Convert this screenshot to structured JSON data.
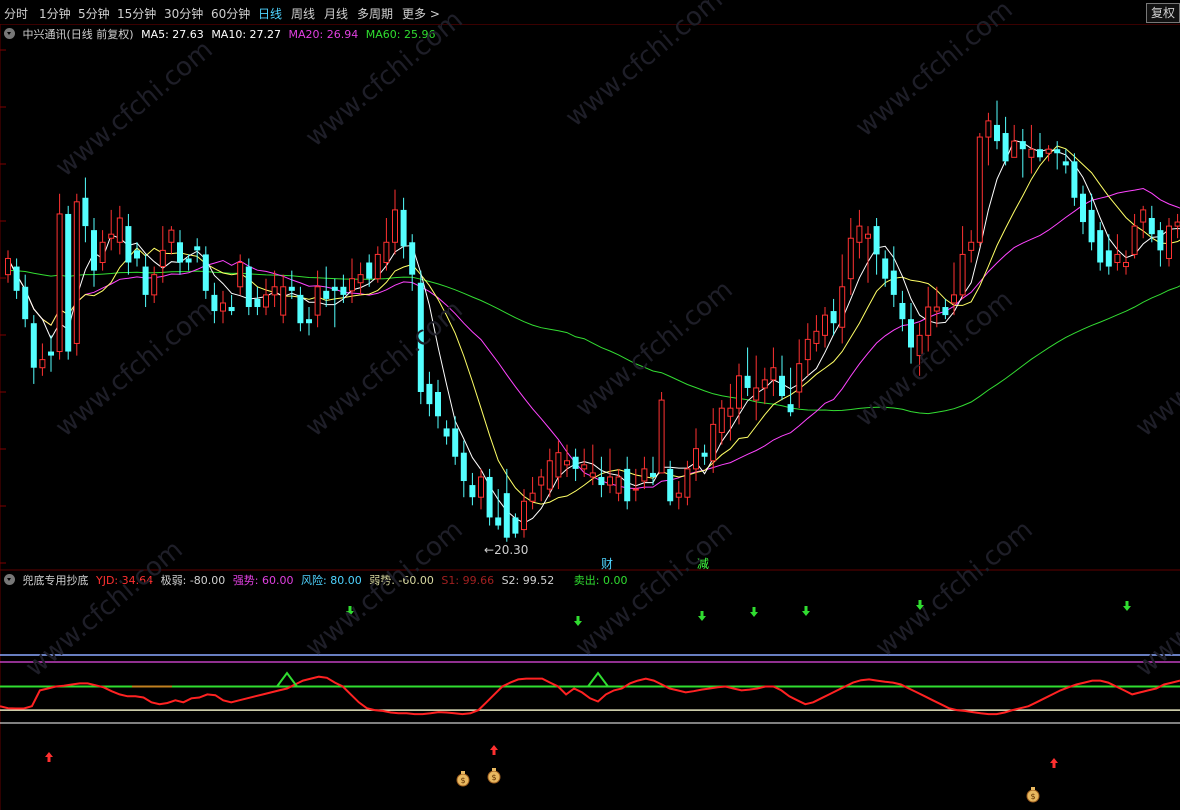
{
  "toolbar": {
    "tabs": [
      "分时",
      "1分钟",
      "5分钟",
      "15分钟",
      "30分钟",
      "60分钟",
      "日线",
      "周线",
      "月线",
      "多周期",
      "更多 >"
    ],
    "active_tab": "日线",
    "restore_button": "复权"
  },
  "main_legend": {
    "title": "中兴通讯(日线 前复权)",
    "ma5": "MA5: 27.63",
    "ma10": "MA10: 27.27",
    "ma20": "MA20: 26.94",
    "ma60": "MA60: 25.96"
  },
  "main_chart": {
    "low_annotation": "20.30",
    "marker_cai": "财",
    "marker_jian": "减"
  },
  "indicator_legend": {
    "name": "兜底专用抄底",
    "yjd": "YJD: 34.64",
    "jiruo": "极弱: -80.00",
    "qiangshi": "强势: 60.00",
    "fengxian": "风险: 80.00",
    "ruoshi": "弱势: -60.00",
    "s1": "S1: 99.66",
    "s2": "S2: 99.52",
    "maichu": "卖出: 0.00"
  },
  "watermark": "www.cfchi.com",
  "colors": {
    "up": "#ff3232",
    "down": "#54ffff",
    "ma5": "#ffffff",
    "ma10": "#ffff66",
    "ma20": "#ff44ff",
    "ma60": "#33dd33",
    "yjd": "#ff2222"
  },
  "chart_data": {
    "type": "candlestick",
    "price_min": 20.3,
    "candles": [
      [
        26.8,
        27.2,
        27.4,
        26.6
      ],
      [
        27.0,
        26.4,
        27.2,
        26.2
      ],
      [
        26.5,
        25.7,
        26.8,
        25.5
      ],
      [
        25.6,
        24.5,
        25.8,
        24.1
      ],
      [
        24.5,
        24.7,
        25.1,
        24.3
      ],
      [
        24.9,
        24.8,
        25.3,
        24.4
      ],
      [
        24.9,
        28.3,
        28.8,
        24.7
      ],
      [
        28.3,
        24.9,
        28.5,
        24.7
      ],
      [
        25.1,
        28.6,
        28.8,
        24.8
      ],
      [
        28.7,
        28.0,
        29.2,
        27.6
      ],
      [
        27.9,
        26.9,
        28.2,
        26.5
      ],
      [
        27.1,
        27.6,
        27.9,
        26.9
      ],
      [
        27.7,
        27.8,
        28.4,
        27.4
      ],
      [
        27.6,
        28.2,
        28.5,
        27.3
      ],
      [
        28.0,
        27.1,
        28.3,
        26.8
      ],
      [
        27.4,
        27.2,
        27.6,
        27.0
      ],
      [
        27.0,
        26.3,
        27.3,
        26.0
      ],
      [
        26.3,
        26.8,
        27.0,
        26.1
      ],
      [
        27.0,
        27.4,
        28.0,
        26.6
      ],
      [
        27.6,
        27.9,
        28.0,
        27.3
      ],
      [
        27.6,
        27.1,
        27.9,
        26.8
      ],
      [
        27.2,
        27.1,
        27.3,
        26.9
      ],
      [
        27.5,
        27.4,
        27.7,
        27.1
      ],
      [
        27.3,
        26.4,
        27.5,
        26.2
      ],
      [
        26.3,
        25.9,
        26.6,
        25.6
      ],
      [
        25.9,
        26.1,
        26.4,
        25.6
      ],
      [
        26.0,
        25.9,
        26.3,
        25.8
      ],
      [
        26.5,
        27.1,
        27.3,
        26.3
      ],
      [
        27.0,
        26.0,
        27.2,
        25.8
      ],
      [
        26.2,
        26.0,
        26.5,
        25.8
      ],
      [
        26.0,
        26.3,
        26.7,
        25.8
      ],
      [
        26.3,
        26.5,
        26.9,
        26.0
      ],
      [
        25.8,
        26.5,
        26.8,
        25.6
      ],
      [
        26.5,
        26.4,
        26.9,
        26.2
      ],
      [
        26.3,
        25.6,
        26.5,
        25.4
      ],
      [
        25.7,
        25.6,
        26.0,
        25.3
      ],
      [
        25.8,
        26.5,
        26.9,
        25.5
      ],
      [
        26.4,
        26.2,
        27.0,
        26.0
      ],
      [
        26.5,
        26.4,
        26.7,
        25.5
      ],
      [
        26.5,
        26.3,
        26.8,
        26.1
      ],
      [
        26.4,
        26.7,
        27.2,
        26.1
      ],
      [
        26.6,
        26.8,
        27.1,
        26.3
      ],
      [
        27.1,
        26.7,
        27.3,
        26.5
      ],
      [
        26.7,
        27.3,
        27.5,
        26.6
      ],
      [
        27.1,
        27.6,
        28.2,
        26.9
      ],
      [
        27.6,
        28.4,
        28.9,
        27.3
      ],
      [
        28.4,
        27.5,
        28.7,
        27.2
      ],
      [
        27.6,
        26.8,
        27.8,
        26.4
      ],
      [
        26.6,
        23.9,
        26.9,
        23.6
      ],
      [
        24.1,
        23.6,
        24.4,
        23.3
      ],
      [
        23.9,
        23.3,
        24.2,
        23.0
      ],
      [
        23.0,
        22.8,
        23.2,
        22.6
      ],
      [
        23.0,
        22.3,
        23.3,
        22.1
      ],
      [
        22.4,
        21.7,
        22.7,
        21.3
      ],
      [
        21.6,
        21.3,
        21.9,
        21.1
      ],
      [
        21.3,
        21.8,
        22.0,
        21.0
      ],
      [
        21.8,
        20.8,
        22.0,
        20.6
      ],
      [
        20.8,
        20.6,
        21.5,
        20.5
      ],
      [
        21.4,
        20.3,
        22.0,
        20.2
      ],
      [
        20.8,
        20.4,
        20.9,
        20.3
      ],
      [
        20.5,
        21.2,
        21.5,
        20.3
      ],
      [
        21.2,
        21.4,
        21.8,
        21.0
      ],
      [
        21.6,
        21.8,
        22.0,
        21.2
      ],
      [
        21.5,
        22.2,
        22.5,
        21.3
      ],
      [
        21.8,
        22.4,
        22.7,
        21.5
      ],
      [
        22.1,
        22.2,
        22.6,
        21.8
      ],
      [
        22.3,
        22.0,
        22.5,
        21.7
      ],
      [
        22.0,
        22.1,
        22.5,
        21.8
      ],
      [
        21.8,
        21.9,
        22.6,
        21.6
      ],
      [
        21.8,
        21.6,
        22.3,
        21.3
      ],
      [
        21.6,
        21.8,
        22.5,
        21.4
      ],
      [
        21.4,
        21.8,
        22.0,
        21.2
      ],
      [
        22.0,
        21.2,
        22.3,
        21.0
      ],
      [
        21.5,
        21.5,
        22.0,
        21.2
      ],
      [
        21.7,
        22.0,
        22.3,
        21.5
      ],
      [
        21.9,
        21.8,
        22.3,
        21.6
      ],
      [
        21.9,
        23.7,
        23.9,
        21.9
      ],
      [
        22.0,
        21.2,
        22.2,
        21.1
      ],
      [
        21.3,
        21.4,
        21.7,
        21.0
      ],
      [
        21.3,
        22.0,
        22.2,
        21.1
      ],
      [
        22.0,
        22.5,
        23.0,
        21.7
      ],
      [
        22.4,
        22.3,
        22.6,
        22.1
      ],
      [
        22.2,
        23.1,
        23.5,
        21.9
      ],
      [
        22.9,
        23.5,
        23.7,
        22.6
      ],
      [
        23.3,
        23.5,
        24.1,
        22.7
      ],
      [
        23.5,
        24.3,
        24.6,
        23.1
      ],
      [
        24.3,
        24.0,
        25.0,
        23.8
      ],
      [
        23.7,
        24.0,
        24.8,
        23.2
      ],
      [
        24.0,
        24.2,
        24.5,
        23.6
      ],
      [
        24.2,
        24.5,
        25.0,
        23.8
      ],
      [
        24.3,
        23.8,
        24.8,
        23.7
      ],
      [
        23.6,
        23.4,
        24.5,
        23.3
      ],
      [
        23.9,
        24.6,
        25.2,
        23.5
      ],
      [
        24.7,
        25.2,
        25.6,
        24.3
      ],
      [
        25.1,
        25.4,
        25.8,
        24.9
      ],
      [
        25.3,
        25.8,
        26.0,
        25.0
      ],
      [
        25.9,
        25.6,
        26.2,
        25.3
      ],
      [
        25.5,
        26.5,
        27.3,
        25.1
      ],
      [
        26.7,
        27.7,
        28.2,
        26.3
      ],
      [
        27.6,
        28.0,
        28.4,
        27.2
      ],
      [
        27.7,
        27.8,
        28.0,
        26.6
      ],
      [
        28.0,
        27.3,
        28.2,
        26.8
      ],
      [
        27.2,
        26.7,
        27.4,
        26.5
      ],
      [
        26.9,
        26.3,
        27.5,
        26.0
      ],
      [
        26.1,
        25.7,
        26.4,
        25.4
      ],
      [
        25.7,
        25.0,
        26.1,
        24.6
      ],
      [
        24.8,
        25.3,
        25.6,
        24.3
      ],
      [
        25.3,
        26.0,
        26.5,
        24.9
      ],
      [
        25.9,
        26.0,
        26.5,
        25.5
      ],
      [
        26.0,
        25.8,
        26.2,
        25.7
      ],
      [
        26.1,
        26.3,
        27.1,
        25.8
      ],
      [
        26.3,
        27.3,
        28.0,
        26.2
      ],
      [
        27.4,
        27.6,
        27.9,
        27.1
      ],
      [
        27.6,
        30.2,
        30.3,
        27.5
      ],
      [
        30.2,
        30.6,
        30.8,
        29.5
      ],
      [
        30.5,
        30.1,
        31.1,
        29.9
      ],
      [
        30.3,
        29.6,
        30.7,
        29.5
      ],
      [
        29.7,
        30.1,
        30.5,
        29.7
      ],
      [
        30.1,
        29.9,
        30.4,
        29.2
      ],
      [
        29.7,
        29.9,
        30.5,
        29.3
      ],
      [
        29.9,
        29.7,
        30.3,
        29.6
      ],
      [
        29.8,
        29.9,
        30.0,
        29.6
      ],
      [
        29.9,
        29.8,
        30.1,
        29.4
      ],
      [
        29.6,
        29.5,
        29.9,
        29.3
      ],
      [
        29.6,
        28.7,
        29.8,
        28.5
      ],
      [
        28.8,
        28.1,
        29.0,
        27.8
      ],
      [
        28.4,
        27.6,
        28.8,
        27.4
      ],
      [
        27.9,
        27.1,
        28.1,
        26.9
      ],
      [
        27.4,
        27.0,
        27.8,
        26.8
      ],
      [
        27.1,
        27.3,
        27.8,
        26.9
      ],
      [
        27.0,
        27.1,
        27.4,
        26.8
      ],
      [
        27.3,
        28.0,
        28.3,
        27.2
      ],
      [
        28.1,
        28.4,
        28.5,
        27.7
      ],
      [
        28.2,
        27.8,
        28.5,
        27.6
      ],
      [
        27.9,
        27.4,
        28.1,
        27.0
      ],
      [
        27.2,
        28.0,
        28.2,
        27.0
      ],
      [
        28.0,
        28.1,
        28.3,
        27.7
      ],
      [
        28.0,
        28.3,
        28.8,
        27.7
      ],
      [
        28.3,
        29.1,
        29.9,
        28.1
      ],
      [
        29.1,
        29.6,
        30.0,
        28.8
      ],
      [
        29.6,
        28.9,
        29.8,
        28.6
      ],
      [
        29.0,
        28.4,
        29.2,
        28.1
      ],
      [
        28.1,
        27.9,
        28.4,
        27.6
      ],
      [
        27.7,
        28.3,
        28.8,
        27.6
      ],
      [
        28.3,
        29.1,
        29.6,
        28.0
      ],
      [
        29.2,
        29.6,
        30.3,
        28.9
      ],
      [
        29.6,
        29.1,
        29.9,
        28.9
      ],
      [
        29.3,
        29.0,
        29.5,
        28.7
      ]
    ],
    "indicator_lines": {
      "jiruo": -80,
      "qiangshi": 60,
      "fengxian": 80,
      "ruoshi": -60
    },
    "yjd": [
      -50,
      -55,
      -56,
      -56,
      -50,
      -10,
      -5,
      0,
      2,
      5,
      8,
      8,
      3,
      -2,
      -12,
      -20,
      -25,
      -25,
      -28,
      -40,
      -45,
      -42,
      -35,
      -40,
      -30,
      -28,
      -20,
      -22,
      -35,
      -40,
      -35,
      -30,
      -25,
      -20,
      -15,
      -10,
      -5,
      5,
      15,
      20,
      25,
      22,
      10,
      0,
      -20,
      -40,
      -55,
      -60,
      -62,
      -66,
      -68,
      -68,
      -70,
      -70,
      -68,
      -65,
      -66,
      -68,
      -70,
      -68,
      -60,
      -40,
      -20,
      0,
      10,
      18,
      20,
      20,
      20,
      10,
      0,
      -20,
      -5,
      -15,
      -30,
      -38,
      -20,
      -10,
      -5,
      8,
      15,
      20,
      15,
      5,
      -5,
      -10,
      -15,
      -12,
      -8,
      -5,
      -2,
      0,
      -5,
      -10,
      -8,
      -5,
      0,
      0,
      -10,
      -25,
      -35,
      -45,
      -40,
      -30,
      -20,
      -10,
      0,
      10,
      16,
      18,
      15,
      12,
      10,
      5,
      -5,
      -15,
      -25,
      -35,
      -45,
      -55,
      -60,
      -62,
      -65,
      -68,
      -70,
      -70,
      -66,
      -60,
      -55,
      -50,
      -40,
      -30,
      -20,
      -10,
      -2,
      5,
      10,
      15,
      15,
      10,
      0,
      -10,
      -20,
      -15,
      -10,
      -5,
      5,
      10,
      15
    ]
  }
}
